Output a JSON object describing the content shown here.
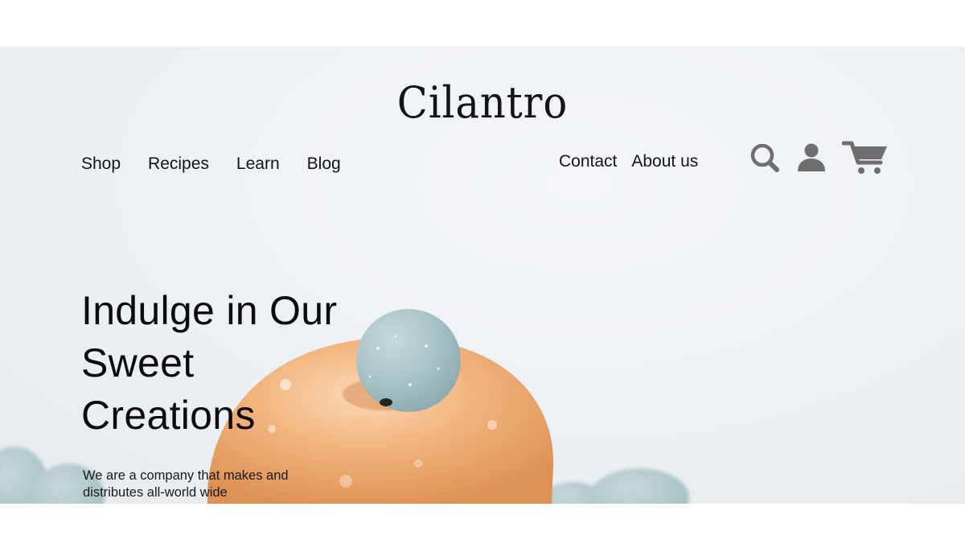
{
  "brand": {
    "logo_text": "Cilantro"
  },
  "nav": {
    "left": [
      {
        "label": "Shop"
      },
      {
        "label": "Recipes"
      },
      {
        "label": "Learn"
      },
      {
        "label": "Blog"
      }
    ],
    "right": [
      {
        "label": "Contact"
      },
      {
        "label": "About us"
      }
    ]
  },
  "icons": {
    "search": "search-icon",
    "account": "user-icon",
    "cart": "cart-icon",
    "color": "#6f6f6f"
  },
  "hero": {
    "title": "Indulge in Our Sweet Creations",
    "subtitle": "We are a company that makes and distributes all-world wide"
  },
  "colors": {
    "background": "#eef1f5",
    "text": "#141414",
    "donut_glaze": "#f1b27a",
    "candy_egg": "#a9c4c8"
  }
}
